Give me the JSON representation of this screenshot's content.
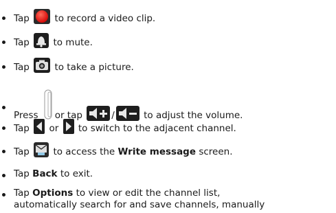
{
  "items": [
    {
      "t0": "Tap",
      "t1": "to record a video clip.",
      "icon": "record-button-icon"
    },
    {
      "t0": "Tap",
      "t1": "to mute.",
      "icon": "mute-bell-icon"
    },
    {
      "t0": "Tap",
      "t1": "to take a picture.",
      "icon": "camera-icon"
    },
    {
      "t0": "Press",
      "sep1": "/",
      "t1": "or tap",
      "sep2": "/",
      "t2": "to adjust the volume.",
      "icons": [
        "volume-side-key-icon",
        "volume-up-icon",
        "volume-down-icon"
      ]
    },
    {
      "t0": "Tap",
      "t1": "or",
      "t2": "to switch to the adjacent channel.",
      "icons": [
        "previous-channel-icon",
        "next-channel-icon"
      ]
    },
    {
      "t0": "Tap",
      "t1": "to access the",
      "bold": "Write message",
      "t2": "screen.",
      "icon": "write-message-icon"
    },
    {
      "t0": "Tap",
      "bold": "Back",
      "t1": "to exit."
    },
    {
      "t0": "Tap",
      "bold": "Options",
      "t1": "to view or edit the channel list,",
      "line2": "automatically search for and save channels, manually"
    }
  ]
}
